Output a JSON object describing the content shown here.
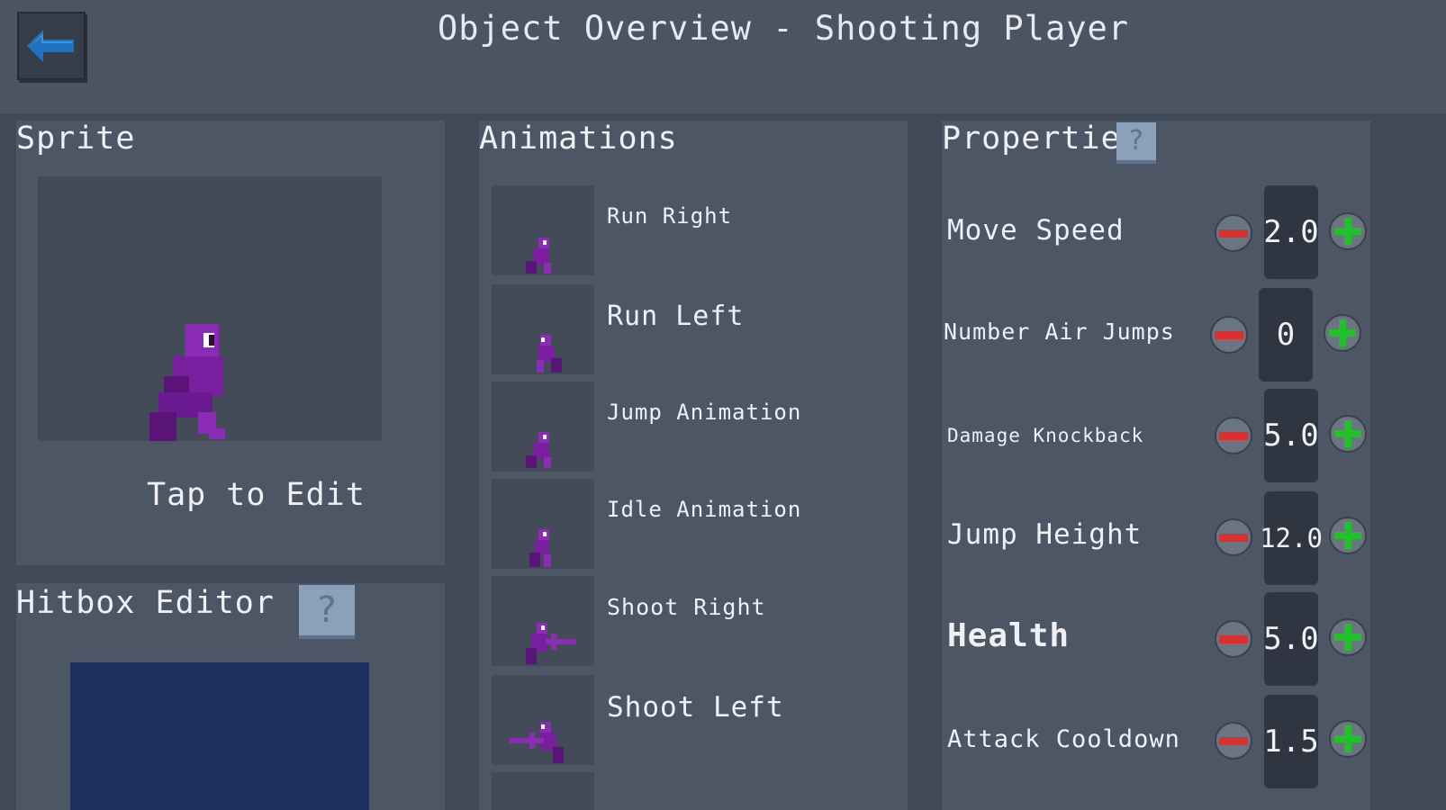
{
  "header": {
    "title": "Object Overview - Shooting Player"
  },
  "sprite_panel": {
    "title": "Sprite",
    "tap_label": "Tap to Edit"
  },
  "hitbox_panel": {
    "title": "Hitbox Editor",
    "help": "?"
  },
  "animations_panel": {
    "title": "Animations",
    "items": [
      {
        "label": "Run Right"
      },
      {
        "label": "Run Left"
      },
      {
        "label": "Jump Animation"
      },
      {
        "label": "Idle Animation"
      },
      {
        "label": "Shoot Right"
      },
      {
        "label": "Shoot Left"
      }
    ]
  },
  "properties_panel": {
    "title": "Properties",
    "help": "?",
    "items": [
      {
        "label": "Move Speed",
        "value": "2.0"
      },
      {
        "label": "Number Air Jumps",
        "value": "0"
      },
      {
        "label": "Damage Knockback",
        "value": "5.0"
      },
      {
        "label": "Jump Height",
        "value": "12.0"
      },
      {
        "label": "Health",
        "value": "5.0"
      },
      {
        "label": "Attack Cooldown",
        "value": "1.5"
      }
    ]
  },
  "icons": {
    "back": "arrow-left-icon",
    "minus": "minus-icon",
    "plus": "plus-icon",
    "help": "question-icon"
  },
  "colors": {
    "accent_back_arrow": "#1e73be",
    "character_purple": "#7a1ea0",
    "minus_red": "#d93030",
    "plus_green": "#22c02a",
    "hitbox_fill": "#1e3060"
  }
}
